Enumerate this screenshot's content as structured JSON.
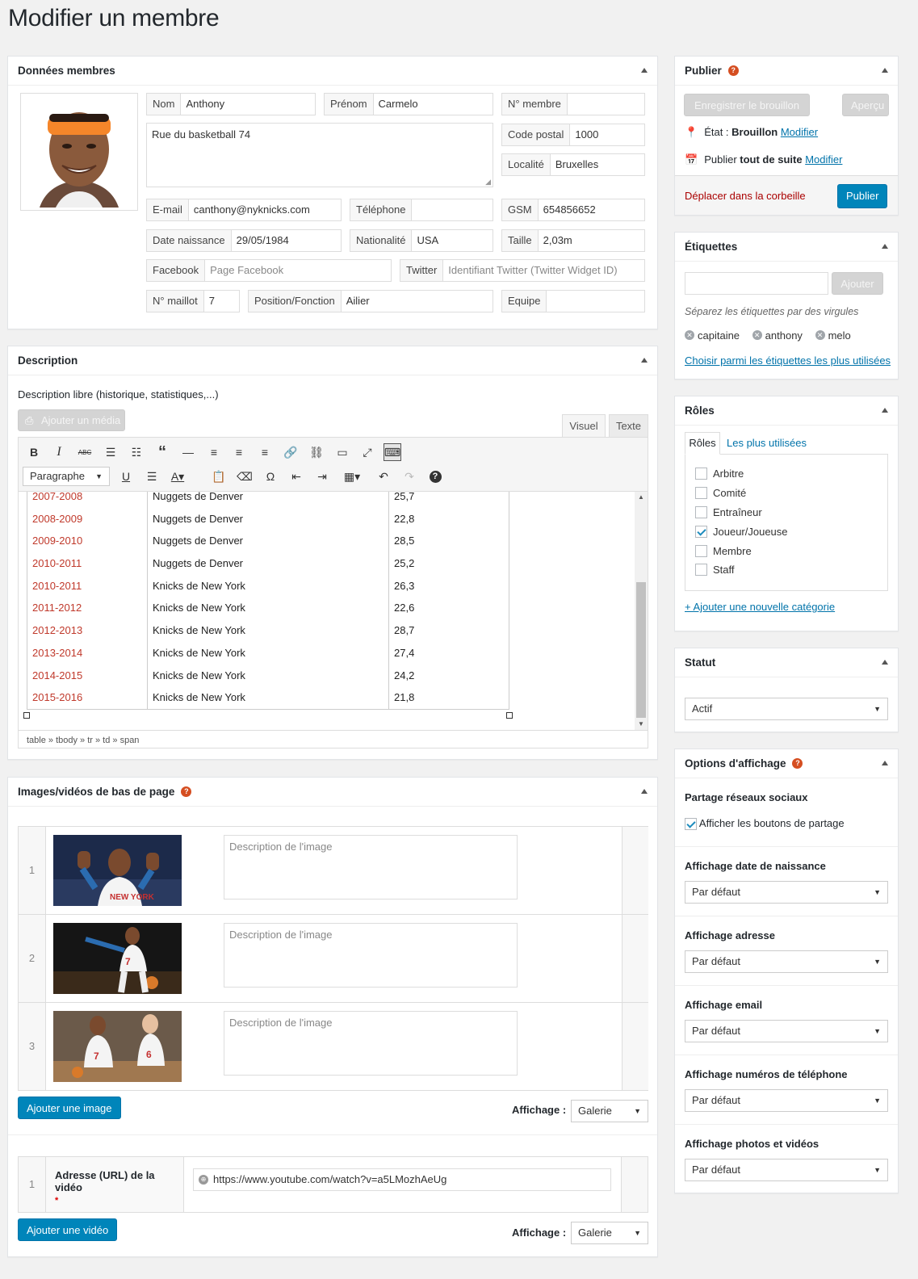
{
  "page": {
    "title": "Modifier un membre"
  },
  "member_data": {
    "title": "Données membres",
    "nom": {
      "label": "Nom",
      "value": "Anthony"
    },
    "prenom": {
      "label": "Prénom",
      "value": "Carmelo"
    },
    "numero": {
      "label": "N° membre",
      "value": ""
    },
    "address": "Rue du basketball 74",
    "code_postal": {
      "label": "Code postal",
      "value": "1000"
    },
    "localite": {
      "label": "Localité",
      "value": "Bruxelles"
    },
    "email": {
      "label": "E-mail",
      "value": "canthony@nyknicks.com"
    },
    "telephone": {
      "label": "Téléphone",
      "value": ""
    },
    "gsm": {
      "label": "GSM",
      "value": "654856652"
    },
    "date_naissance": {
      "label": "Date naissance",
      "value": "29/05/1984"
    },
    "nationalite": {
      "label": "Nationalité",
      "value": "USA"
    },
    "taille": {
      "label": "Taille",
      "value": "2,03m"
    },
    "facebook": {
      "label": "Facebook",
      "placeholder": "Page Facebook"
    },
    "twitter": {
      "label": "Twitter",
      "placeholder": "Identifiant Twitter (Twitter Widget ID)"
    },
    "maillot": {
      "label": "N° maillot",
      "value": "7"
    },
    "position": {
      "label": "Position/Fonction",
      "value": "Ailier"
    },
    "equipe": {
      "label": "Equipe",
      "value": ""
    }
  },
  "description": {
    "title": "Description",
    "label": "Description libre (historique, statistiques,...)",
    "add_media": "Ajouter un média",
    "tab_visual": "Visuel",
    "tab_text": "Texte",
    "format_select": "Paragraphe",
    "rows": [
      [
        "2007-2008",
        "Nuggets de Denver",
        "25,7"
      ],
      [
        "2008-2009",
        "Nuggets de Denver",
        "22,8"
      ],
      [
        "2009-2010",
        "Nuggets de Denver",
        "28,5"
      ],
      [
        "2010-2011",
        "Nuggets de Denver",
        "25,2"
      ],
      [
        "2010-2011",
        "Knicks de New York",
        "26,3"
      ],
      [
        "2011-2012",
        "Knicks de New York",
        "22,6"
      ],
      [
        "2012-2013",
        "Knicks de New York",
        "28,7"
      ],
      [
        "2013-2014",
        "Knicks de New York",
        "27,4"
      ],
      [
        "2014-2015",
        "Knicks de New York",
        "24,2"
      ],
      [
        "2015-2016",
        "Knicks de New York",
        "21,8"
      ]
    ],
    "path": "table » tbody » tr » td » span"
  },
  "media": {
    "title": "Images/vidéos de bas de page",
    "image_placeholder": "Description de l'image",
    "rows": [
      "1",
      "2",
      "3"
    ],
    "add_image": "Ajouter une image",
    "display_label": "Affichage :",
    "display_value": "Galerie",
    "video_num": "1",
    "video_label": "Adresse (URL) de la vidéo",
    "video_required": "*",
    "video_url": "https://www.youtube.com/watch?v=a5LMozhAeUg",
    "add_video": "Ajouter une vidéo"
  },
  "publish": {
    "title": "Publier",
    "save_draft": "Enregistrer le brouillon",
    "preview": "Aperçu",
    "state_label": "État :",
    "state_value": "Brouillon",
    "modify": "Modifier",
    "publish_label": "Publier",
    "publish_when": "tout de suite",
    "trash": "Déplacer dans la corbeille",
    "publish_btn": "Publier"
  },
  "tags": {
    "title": "Étiquettes",
    "add": "Ajouter",
    "hint": "Séparez les étiquettes par des virgules",
    "items": [
      "capitaine",
      "anthony",
      "melo"
    ],
    "choose": "Choisir parmi les étiquettes les plus utilisées"
  },
  "roles": {
    "title": "Rôles",
    "tab_all": "Rôles",
    "tab_used": "Les plus utilisées",
    "items": [
      {
        "label": "Arbitre",
        "checked": false
      },
      {
        "label": "Comité",
        "checked": false
      },
      {
        "label": "Entraîneur",
        "checked": false
      },
      {
        "label": "Joueur/Joueuse",
        "checked": true
      },
      {
        "label": "Membre",
        "checked": false
      },
      {
        "label": "Staff",
        "checked": false
      }
    ],
    "add_new": "+ Ajouter une nouvelle catégorie"
  },
  "status": {
    "title": "Statut",
    "value": "Actif"
  },
  "display_options": {
    "title": "Options d'affichage",
    "share_title": "Partage réseaux sociaux",
    "share_check": "Afficher les boutons de partage",
    "sections": [
      {
        "title": "Affichage date de naissance",
        "value": "Par défaut"
      },
      {
        "title": "Affichage adresse",
        "value": "Par défaut"
      },
      {
        "title": "Affichage email",
        "value": "Par défaut"
      },
      {
        "title": "Affichage numéros de téléphone",
        "value": "Par défaut"
      },
      {
        "title": "Affichage photos et vidéos",
        "value": "Par défaut"
      }
    ]
  },
  "colors": {
    "accent": "#0085ba",
    "link": "#0073aa",
    "season": "#c0392b",
    "danger": "#a00"
  }
}
